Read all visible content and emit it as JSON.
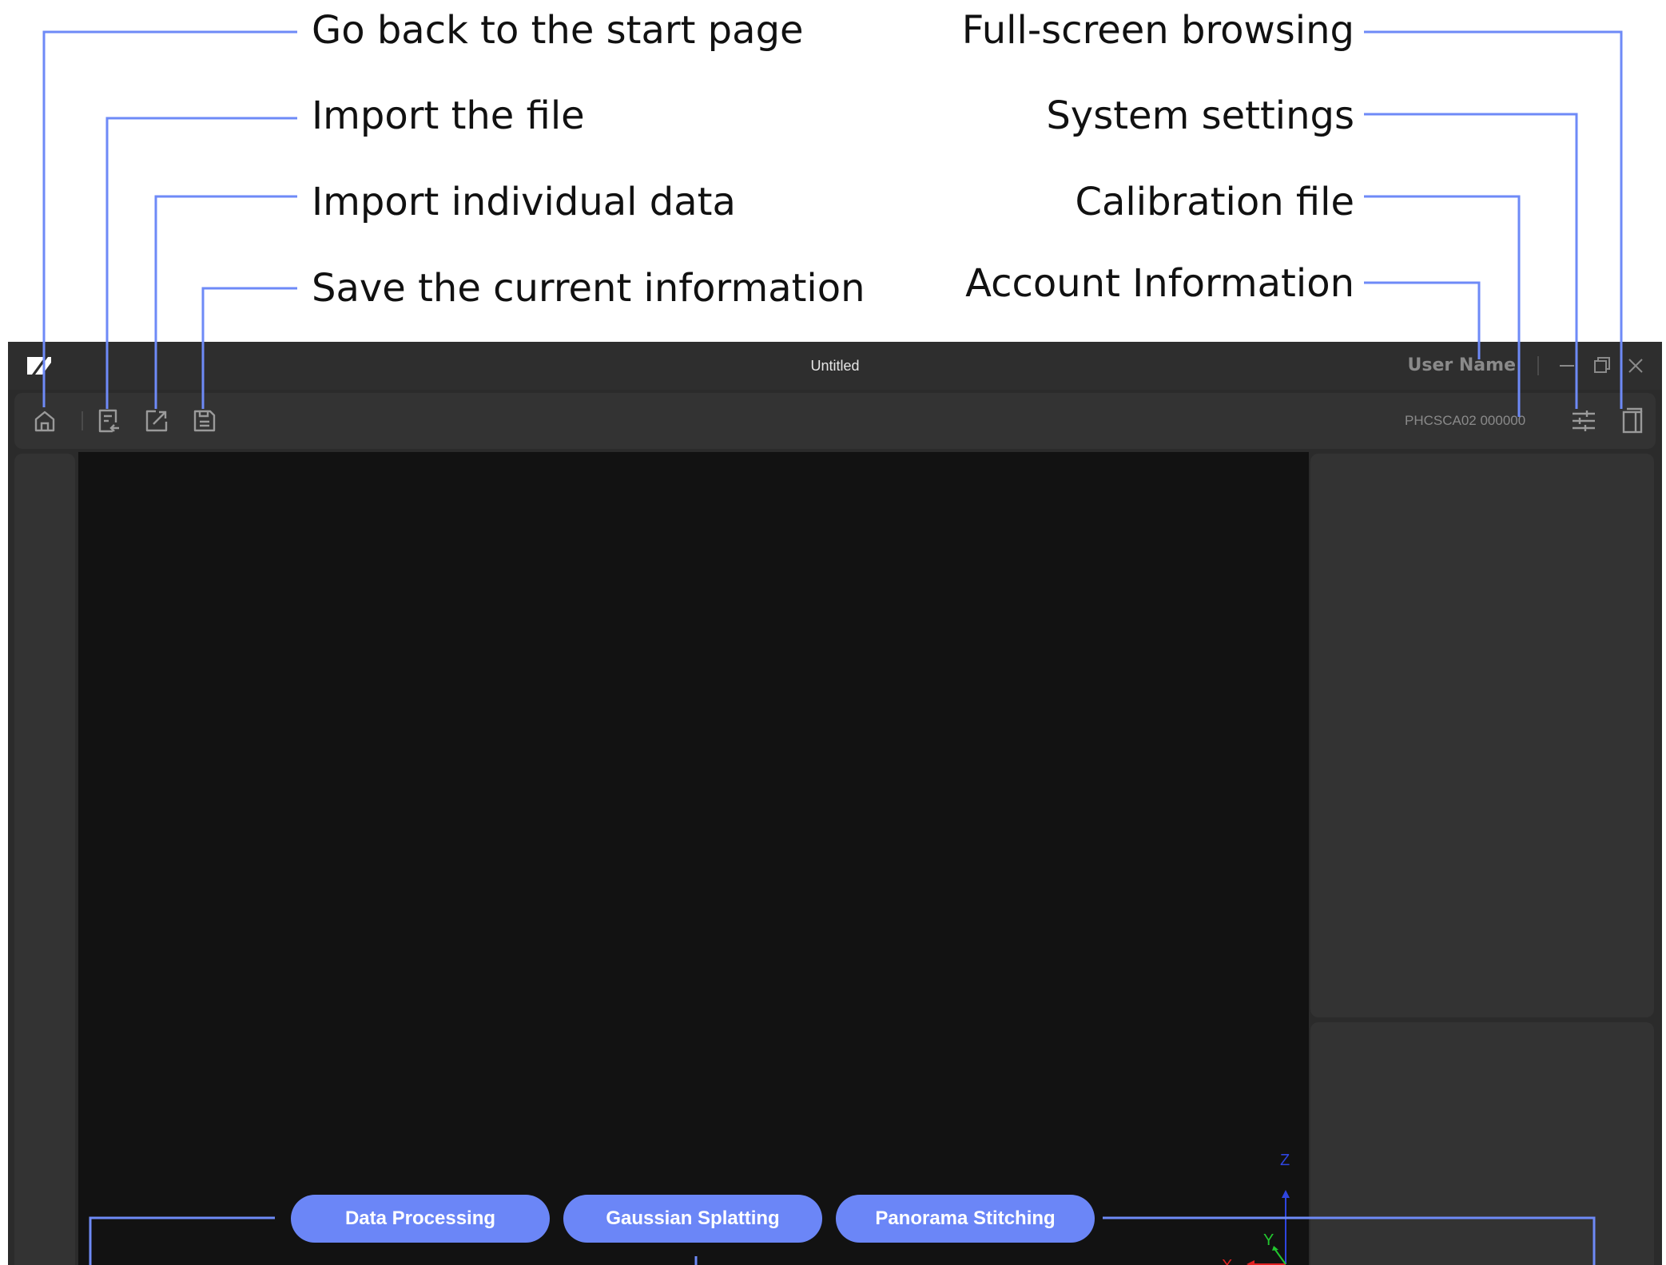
{
  "callouts": {
    "left": [
      "Go back to the start page",
      "Import the file",
      "Import individual data",
      "Save the current information"
    ],
    "right": [
      "Full-screen browsing",
      "System settings",
      "Calibration file",
      "Account Information"
    ]
  },
  "window": {
    "title": "Untitled",
    "user_name": "User Name",
    "device_id": "PHCSCA02 000000",
    "logo_icon": "app-logo-icon",
    "controls": [
      "minimize-icon",
      "restore-icon",
      "close-icon"
    ]
  },
  "toolbar": {
    "icons": [
      "home-icon",
      "import-file-icon",
      "import-data-icon",
      "save-icon",
      "settings-sliders-icon",
      "fullscreen-icon"
    ]
  },
  "axes": {
    "x": "X",
    "y": "Y",
    "z": "Z"
  },
  "modes": [
    "Data Processing",
    "Gaussian Splatting",
    "Panorama Stitching"
  ],
  "colors": {
    "accent": "#6b86f7",
    "leader_line": "#6e8af7",
    "axis_x": "#e02020",
    "axis_y": "#22c72e",
    "axis_z": "#2f45e0",
    "viewport": "#121212",
    "panel": "#333333"
  }
}
